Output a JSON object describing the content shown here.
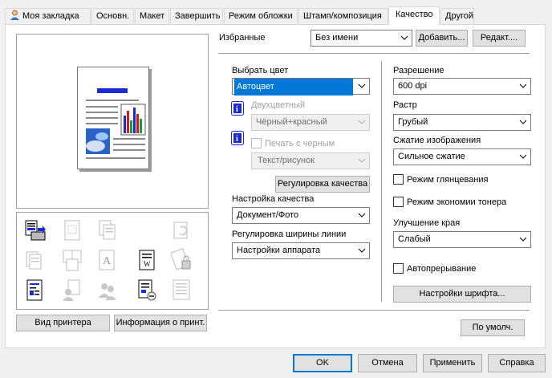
{
  "tabs": [
    {
      "label": "Моя закладка"
    },
    {
      "label": "Основн."
    },
    {
      "label": "Макет"
    },
    {
      "label": "Завершить"
    },
    {
      "label": "Режим обложки"
    },
    {
      "label": "Штамп/композиция"
    },
    {
      "label": "Качество"
    },
    {
      "label": "Другой"
    }
  ],
  "favorites": {
    "label": "Избранные",
    "value": "Без имени",
    "add_label": "Добавить...",
    "edit_label": "Редакт...."
  },
  "left": {
    "printer_view_label": "Вид принтера",
    "printer_info_label": "Информация о принт."
  },
  "color": {
    "label": "Выбрать цвет",
    "value": "Автоцвет",
    "two_color_label": "Двухцветный",
    "two_color_value": "Чёрный+красный",
    "print_black_label": "Печать с черным",
    "print_black_value": "Текст/рисунок",
    "quality_adjust_label": "Регулировка качества"
  },
  "quality": {
    "label": "Настройка качества",
    "value": "Документ/Фото"
  },
  "line_width": {
    "label": "Регулировка ширины линии",
    "value": "Настройки аппарата"
  },
  "resolution": {
    "label": "Разрешение",
    "value": "600 dpi"
  },
  "raster": {
    "label": "Растр",
    "value": "Грубый"
  },
  "compression": {
    "label": "Сжатие изображения",
    "value": "Сильное сжатие"
  },
  "gloss_label": "Режим глянцевания",
  "toner_save_label": "Режим экономии тонера",
  "edge": {
    "label": "Улучшение края",
    "value": "Слабый"
  },
  "auto_trap_label": "Автопрерывание",
  "font_settings_label": "Настройки шрифта...",
  "defaults_label": "По умолч.",
  "footer": {
    "ok": "OK",
    "cancel": "Отмена",
    "apply": "Применить",
    "help": "Справка"
  },
  "colors": {
    "accent": "#0078d7",
    "chart_blue": "#1a2bd6",
    "chart_red": "#d61a1a",
    "chart_green": "#1a9a3a"
  }
}
